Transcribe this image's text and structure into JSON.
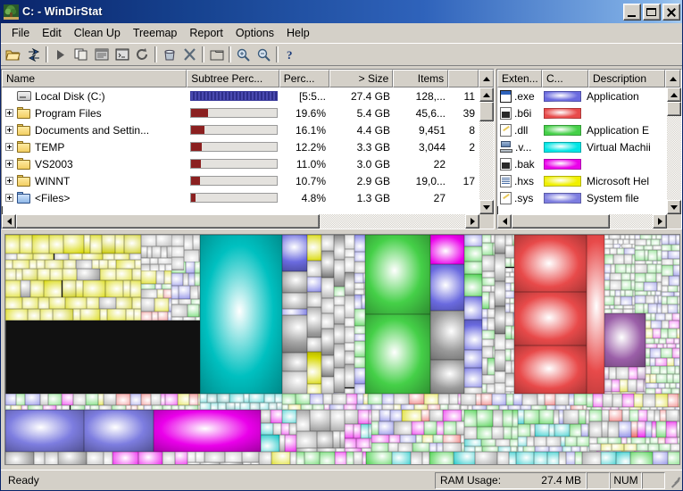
{
  "window": {
    "title": "C: - WinDirStat",
    "icon": "windirstat-tree-icon",
    "minimize_label": "Minimize",
    "maximize_label": "Maximize",
    "close_label": "Close"
  },
  "menu": {
    "items": [
      {
        "label": "File"
      },
      {
        "label": "Edit"
      },
      {
        "label": "Clean Up"
      },
      {
        "label": "Treemap"
      },
      {
        "label": "Report"
      },
      {
        "label": "Options"
      },
      {
        "label": "Help"
      }
    ]
  },
  "toolbar": {
    "buttons": [
      {
        "name": "open-folder-button",
        "icon": "open-folder-icon"
      },
      {
        "name": "rescan-button",
        "icon": "refresh-arrows-icon"
      },
      {
        "name": "continue-button",
        "icon": "play-triangle-icon"
      },
      {
        "name": "copy-button",
        "icon": "copy-icon"
      },
      {
        "name": "explorer-here-button",
        "icon": "explorer-window-icon"
      },
      {
        "name": "command-prompt-button",
        "icon": "console-icon"
      },
      {
        "name": "refresh-selected-button",
        "icon": "refresh-circle-icon"
      },
      {
        "name": "recycle-bin-button",
        "icon": "recycle-bin-icon"
      },
      {
        "name": "delete-button",
        "icon": "delete-x-icon"
      },
      {
        "name": "show-treemap-button",
        "icon": "folder-outline-icon"
      },
      {
        "name": "zoom-in-button",
        "icon": "zoom-in-icon"
      },
      {
        "name": "zoom-out-button",
        "icon": "zoom-out-icon"
      },
      {
        "name": "help-button",
        "icon": "question-mark-icon"
      }
    ]
  },
  "directory_list": {
    "columns": [
      {
        "key": "name",
        "label": "Name"
      },
      {
        "key": "bar",
        "label": "Subtree Perc..."
      },
      {
        "key": "pct",
        "label": "Perc..."
      },
      {
        "key": "size",
        "label": "> Size"
      },
      {
        "key": "items",
        "label": "Items"
      }
    ],
    "rows": [
      {
        "name": "Local Disk (C:)",
        "icon": "drive-icon",
        "expandable": false,
        "indent": 0,
        "bar_pct": 100,
        "bar_color": "#3b3b9c",
        "pct": "[5:5...",
        "size": "27.4 GB",
        "items": "128,...",
        "files": "11"
      },
      {
        "name": "Program Files",
        "icon": "folder-icon",
        "expandable": true,
        "indent": 1,
        "bar_pct": 19.6,
        "bar_color": "#8b2020",
        "pct": "19.6%",
        "size": "5.4 GB",
        "items": "45,6...",
        "files": "39"
      },
      {
        "name": "Documents and Settin...",
        "icon": "folder-icon",
        "expandable": true,
        "indent": 1,
        "bar_pct": 16.1,
        "bar_color": "#8b2020",
        "pct": "16.1%",
        "size": "4.4 GB",
        "items": "9,451",
        "files": "8"
      },
      {
        "name": "TEMP",
        "icon": "folder-icon",
        "expandable": true,
        "indent": 1,
        "bar_pct": 12.2,
        "bar_color": "#8b2020",
        "pct": "12.2%",
        "size": "3.3 GB",
        "items": "3,044",
        "files": "2"
      },
      {
        "name": "VS2003",
        "icon": "folder-icon",
        "expandable": true,
        "indent": 1,
        "bar_pct": 11.0,
        "bar_color": "#8b2020",
        "pct": "11.0%",
        "size": "3.0 GB",
        "items": "22",
        "files": ""
      },
      {
        "name": "WINNT",
        "icon": "folder-icon",
        "expandable": true,
        "indent": 1,
        "bar_pct": 10.7,
        "bar_color": "#8b2020",
        "pct": "10.7%",
        "size": "2.9 GB",
        "items": "19,0...",
        "files": "17"
      },
      {
        "name": "<Files>",
        "icon": "folder-blue-icon",
        "expandable": true,
        "indent": 1,
        "bar_pct": 4.8,
        "bar_color": "#8b2020",
        "pct": "4.8%",
        "size": "1.3 GB",
        "items": "27",
        "files": ""
      }
    ]
  },
  "extension_list": {
    "columns": [
      {
        "key": "ext",
        "label": "Exten..."
      },
      {
        "key": "color",
        "label": "C..."
      },
      {
        "key": "desc",
        "label": "Description"
      }
    ],
    "rows": [
      {
        "ext": ".exe",
        "icon": "application-window-icon",
        "color": "#6a6adf",
        "desc": "Application"
      },
      {
        "ext": ".b6i",
        "icon": "image-file-icon",
        "color": "#e84a4a",
        "desc": ""
      },
      {
        "ext": ".dll",
        "icon": "dll-file-icon",
        "color": "#45d048",
        "desc": "Application E"
      },
      {
        "ext": ".v...",
        "icon": "virtual-machine-icon",
        "color": "#00e5e5",
        "desc": "Virtual Machii"
      },
      {
        "ext": ".bak",
        "icon": "image-file-icon",
        "color": "#ea00ea",
        "desc": ""
      },
      {
        "ext": ".hxs",
        "icon": "help-file-icon",
        "color": "#f0f000",
        "desc": "Microsoft Hel"
      },
      {
        "ext": ".sys",
        "icon": "dll-file-icon",
        "color": "#7d7de0",
        "desc": "System file"
      }
    ]
  },
  "treemap": {
    "label": "treemap-canvas",
    "palette": {
      "exe": "#6a6adf",
      "b6i": "#e84a4a",
      "dll": "#45d048",
      "vm": "#00c0c0",
      "bak": "#ea00ea",
      "hxs": "#d8d800",
      "sys": "#7d7de0",
      "other": "#9a9a9a",
      "purple": "#9b5fa8"
    }
  },
  "statusbar": {
    "message": "Ready",
    "ram_label": "RAM Usage:",
    "ram_value": "27.4 MB",
    "blank_1": "",
    "num_lock": "NUM",
    "blank_2": ""
  }
}
